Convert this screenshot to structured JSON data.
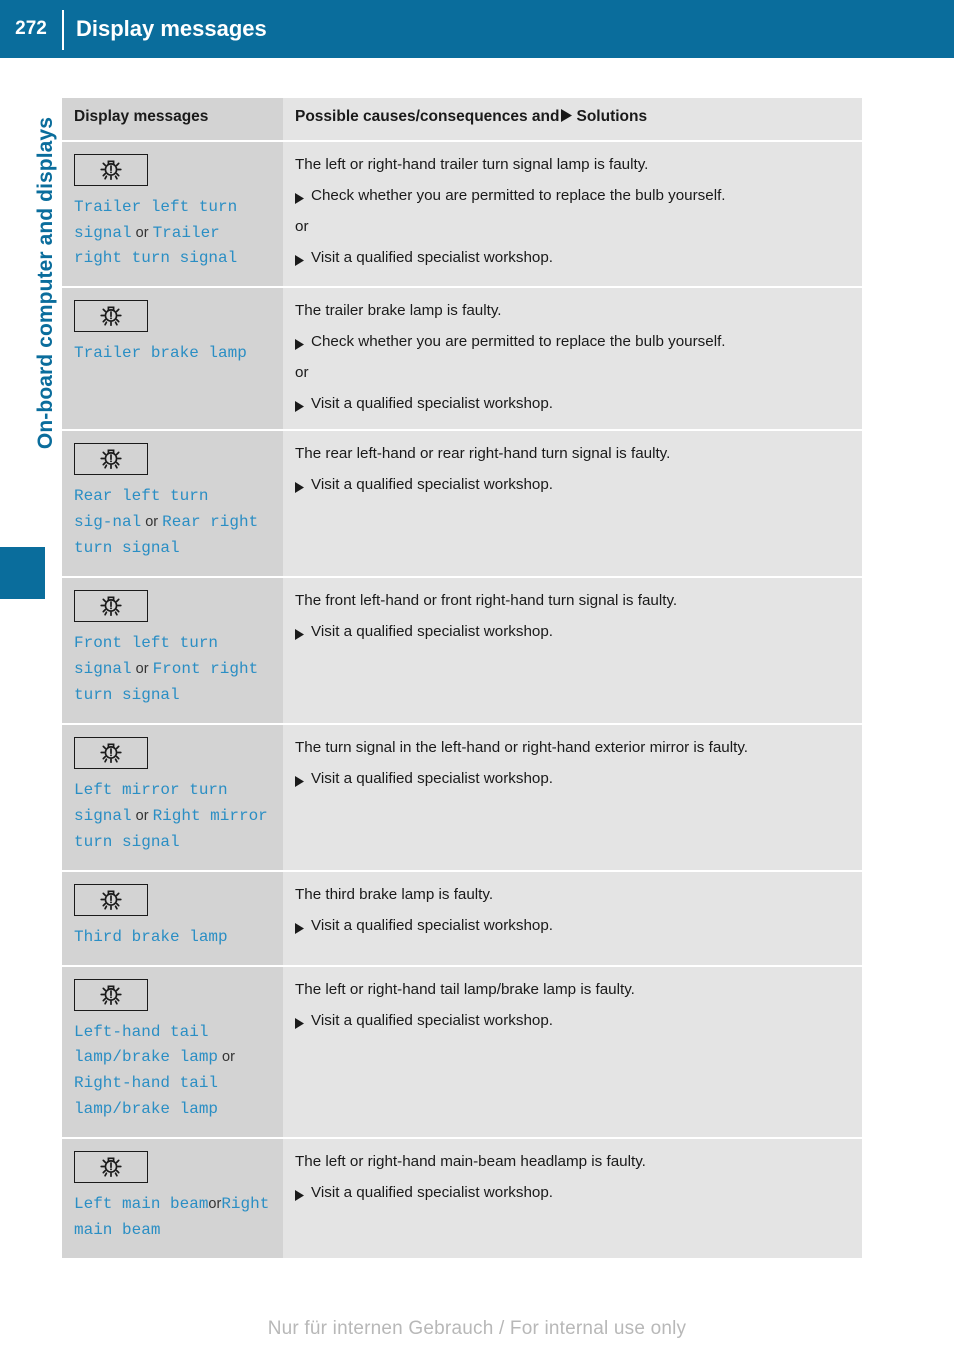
{
  "header": {
    "page_number": "272",
    "title": "Display messages"
  },
  "sidebar": {
    "chapter_label": "On-board computer and displays"
  },
  "table": {
    "columns": {
      "left": "Display messages",
      "right_before_triangle": "Possible causes/consequences and",
      "right_after_triangle": "Solutions"
    },
    "rows": [
      {
        "icon": "lamp-warning-icon",
        "message_parts": [
          {
            "type": "msg",
            "text": "Trailer left turn signal"
          },
          {
            "type": "or",
            "text": " or "
          },
          {
            "type": "msg",
            "text": "Trailer right turn signal"
          }
        ],
        "cause": "The left or right-hand trailer turn signal lamp is faulty.",
        "steps": [
          "Check whether you are permitted to replace the bulb yourself."
        ],
        "or_label": "or",
        "steps_after_or": [
          "Visit a qualified specialist workshop."
        ]
      },
      {
        "icon": "lamp-warning-icon",
        "message_parts": [
          {
            "type": "msg",
            "text": "Trailer brake lamp"
          }
        ],
        "cause": "The trailer brake lamp is faulty.",
        "steps": [
          "Check whether you are permitted to replace the bulb yourself."
        ],
        "or_label": "or",
        "steps_after_or": [
          "Visit a qualified specialist workshop."
        ]
      },
      {
        "icon": "lamp-warning-icon",
        "message_parts": [
          {
            "type": "msg",
            "text": "Rear left turn sig‑nal"
          },
          {
            "type": "or",
            "text": " or "
          },
          {
            "type": "msg",
            "text": "Rear right turn signal"
          }
        ],
        "cause": "The rear left-hand or rear right-hand turn signal is faulty.",
        "steps": [],
        "or_label": "",
        "steps_after_or": [
          "Visit a qualified specialist workshop."
        ]
      },
      {
        "icon": "lamp-warning-icon",
        "message_parts": [
          {
            "type": "msg",
            "text": "Front left turn signal"
          },
          {
            "type": "or",
            "text": " or "
          },
          {
            "type": "msg",
            "text": "Front right turn signal"
          }
        ],
        "cause": "The front left-hand or front right-hand turn signal is faulty.",
        "steps": [],
        "or_label": "",
        "steps_after_or": [
          "Visit a qualified specialist workshop."
        ]
      },
      {
        "icon": "lamp-warning-icon",
        "message_parts": [
          {
            "type": "msg",
            "text": "Left mirror turn signal"
          },
          {
            "type": "or",
            "text": " or "
          },
          {
            "type": "msg",
            "text": "Right mirror turn signal"
          }
        ],
        "cause": "The turn signal in the left-hand or right-hand exterior mirror is faulty.",
        "steps": [],
        "or_label": "",
        "steps_after_or": [
          "Visit a qualified specialist workshop."
        ]
      },
      {
        "icon": "lamp-warning-icon",
        "message_parts": [
          {
            "type": "msg",
            "text": "Third brake lamp"
          }
        ],
        "cause": "The third brake lamp is faulty.",
        "steps": [],
        "or_label": "",
        "steps_after_or": [
          "Visit a qualified specialist workshop."
        ]
      },
      {
        "icon": "lamp-warning-icon",
        "message_parts": [
          {
            "type": "msg",
            "text": "Left-hand tail lamp/brake lamp"
          },
          {
            "type": "or",
            "text": " or "
          },
          {
            "type": "msg",
            "text": "Right-hand tail lamp/brake lamp"
          }
        ],
        "cause": "The left or right-hand tail lamp/brake lamp is faulty.",
        "steps": [],
        "or_label": "",
        "steps_after_or": [
          "Visit a qualified specialist workshop."
        ]
      },
      {
        "icon": "lamp-warning-icon",
        "message_parts": [
          {
            "type": "msg",
            "text": "Left main beam"
          },
          {
            "type": "or",
            "text": "or"
          },
          {
            "type": "msg",
            "text": "Right main beam"
          }
        ],
        "cause": "The left or right-hand main-beam headlamp is faulty.",
        "steps": [],
        "or_label": "",
        "steps_after_or": [
          "Visit a qualified specialist workshop."
        ]
      }
    ]
  },
  "footer": {
    "text": "Nur für internen Gebrauch / For internal use only"
  },
  "colors": {
    "brand_blue": "#0a6d9c",
    "message_blue": "#2a8ec4",
    "cell_left_gray": "#d3d3d3",
    "cell_right_gray": "#e4e4e4",
    "footer_gray": "#b8b8b8"
  }
}
